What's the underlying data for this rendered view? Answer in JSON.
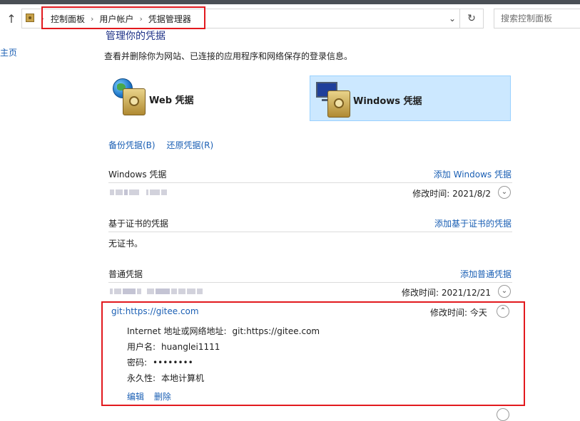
{
  "address_bar": {
    "crumbs": [
      "控制面板",
      "用户帐户",
      "凭据管理器"
    ],
    "search_placeholder": "搜索控制面板"
  },
  "sidebar": {
    "home_label": "主页"
  },
  "main": {
    "title": "管理你的凭据",
    "description": "查看并删除你为网站、已连接的应用程序和网络保存的登录信息。",
    "tiles": [
      {
        "label": "Web 凭据",
        "selected": false,
        "icon": "web-credentials-icon"
      },
      {
        "label": "Windows 凭据",
        "selected": true,
        "icon": "windows-credentials-icon"
      }
    ],
    "backup_label": "备份凭据(B)",
    "restore_label": "还原凭据(R)",
    "sections": {
      "windows": {
        "title": "Windows 凭据",
        "add_label": "添加 Windows 凭据",
        "items": [
          {
            "meta": "修改时间:  2021/8/2"
          }
        ]
      },
      "certificate": {
        "title": "基于证书的凭据",
        "add_label": "添加基于证书的凭据",
        "empty_text": "无证书。"
      },
      "generic": {
        "title": "普通凭据",
        "add_label": "添加普通凭据",
        "items": [
          {
            "meta": "修改时间:  2021/12/21"
          }
        ],
        "expanded": {
          "name": "git:https://gitee.com",
          "meta": "修改时间:  今天",
          "details": [
            {
              "key": "Internet 地址或网络地址:",
              "value": "git:https://gitee.com"
            },
            {
              "key": "用户名:",
              "value": "huanglei1111"
            },
            {
              "key": "密码:",
              "value": "••••••••"
            },
            {
              "key": "永久性:",
              "value": "本地计算机"
            }
          ],
          "edit_label": "编辑",
          "delete_label": "删除"
        }
      }
    }
  },
  "colors": {
    "link": "#1a5fb4",
    "highlight_box": "#e2191e",
    "selected_tile": "#cce8ff"
  }
}
